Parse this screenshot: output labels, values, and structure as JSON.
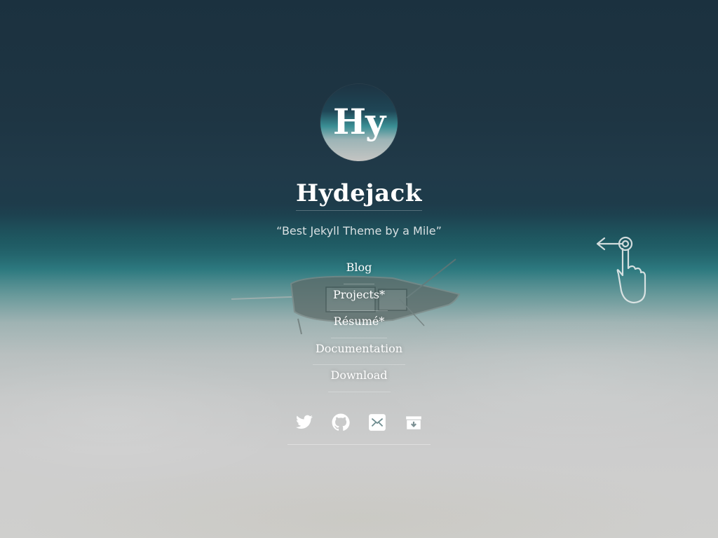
{
  "sidebar": {
    "avatar_text": "Hy",
    "title": "Hydejack",
    "tagline": "“Best Jekyll Theme by a Mile”",
    "nav": [
      {
        "label": "Blog"
      },
      {
        "label": "Projects*"
      },
      {
        "label": "Résumé*"
      },
      {
        "label": "Documentation"
      },
      {
        "label": "Download"
      }
    ],
    "social": [
      {
        "icon": "twitter-icon"
      },
      {
        "icon": "github-icon"
      },
      {
        "icon": "email-icon"
      },
      {
        "icon": "rss-icon"
      }
    ]
  },
  "swipe_hint": {
    "icon": "swipe-left-hand-icon"
  },
  "colors": {
    "accent": "#3a8f95",
    "text": "#ffffff",
    "dark_sea": "#1b313f",
    "sand": "#cfcfcd"
  }
}
